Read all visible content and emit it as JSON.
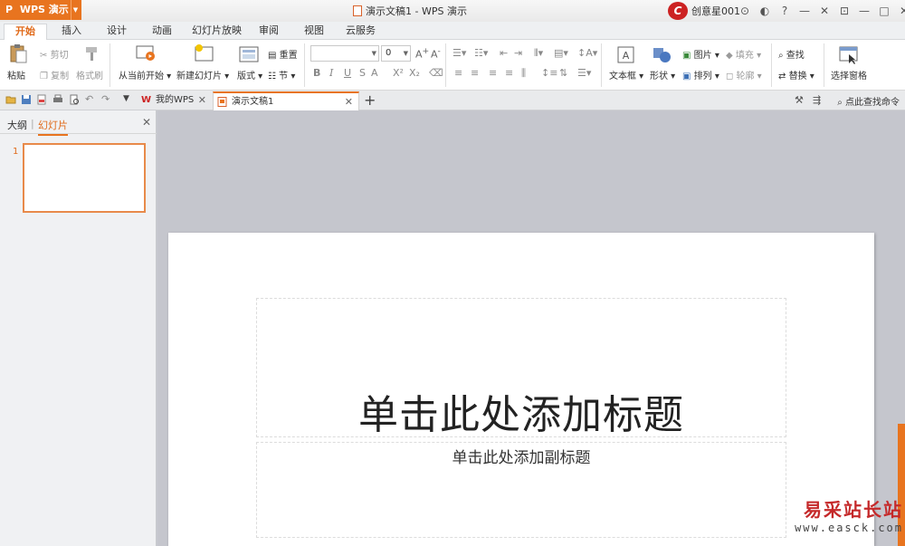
{
  "app": {
    "button_label": "WPS 演示",
    "logo_letter": "P",
    "document_title": "演示文稿1 - WPS 演示",
    "user_name": "创意星001",
    "user_avatar_letter": "C"
  },
  "window_controls": [
    "⊙",
    "◐",
    "?",
    "—",
    "✕",
    "⊡",
    "—",
    "□",
    "✕"
  ],
  "tabs": [
    "开始",
    "插入",
    "设计",
    "动画",
    "幻灯片放映",
    "审阅",
    "视图",
    "云服务"
  ],
  "ribbon": {
    "paste": "粘贴",
    "cut": "剪切",
    "copy": "复制",
    "format_painter": "格式刷",
    "from_current": "从当前开始",
    "new_slide": "新建幻灯片",
    "layout": "版式",
    "reset": "重置",
    "section": "节",
    "font_size": "0",
    "bold": "B",
    "italic": "I",
    "underline": "U",
    "strike": "S",
    "shadow": "A",
    "superscript": "X²",
    "subscript": "X₂",
    "textbox": "文本框",
    "shape": "形状",
    "picture": "图片",
    "fill": "填充",
    "arrange": "排列",
    "outline": "轮廓",
    "find": "查找",
    "replace": "替换",
    "select_pane": "选择窗格"
  },
  "doc_tabs": {
    "my_wps": "我的WPS",
    "current_doc": "演示文稿1",
    "close_glyph": "✕",
    "add_glyph": "+",
    "find_command": "点此查找命令"
  },
  "left_panel": {
    "tab_outline": "大纲",
    "tab_slides": "幻灯片",
    "close_glyph": "✕",
    "slide_number": "1"
  },
  "slide": {
    "title_placeholder": "单击此处添加标题",
    "subtitle_placeholder": "单击此处添加副标题"
  },
  "watermark": {
    "line1": "易采站长站",
    "line2": "www.easck.com"
  },
  "colors": {
    "accent": "#e8741f",
    "active_tab_text": "#e06a1a",
    "canvas_bg": "#c5c6cd"
  }
}
